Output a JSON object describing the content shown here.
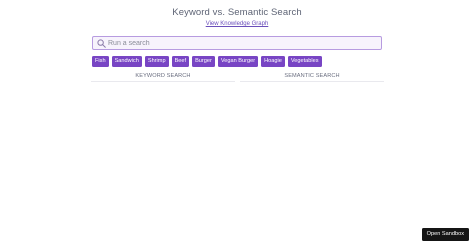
{
  "header": {
    "title": "Keyword vs. Semantic Search",
    "knowledge_graph_link": "View Knowledge Graph"
  },
  "search": {
    "placeholder": "Run a search",
    "value": ""
  },
  "tags": [
    "Fish",
    "Sandwich",
    "Shrimp",
    "Beef",
    "Burger",
    "Vegan Burger",
    "Hoagie",
    "Vegetables"
  ],
  "columns": {
    "keyword_label": "KEYWORD SEARCH",
    "semantic_label": "SEMANTIC SEARCH"
  },
  "footer": {
    "open_sandbox_label": "Open Sandbox"
  },
  "colors": {
    "accent": "#7845c4",
    "search_border": "#b79be0",
    "sandbox_button": "#151515"
  },
  "icons": {
    "search": "search-icon"
  }
}
